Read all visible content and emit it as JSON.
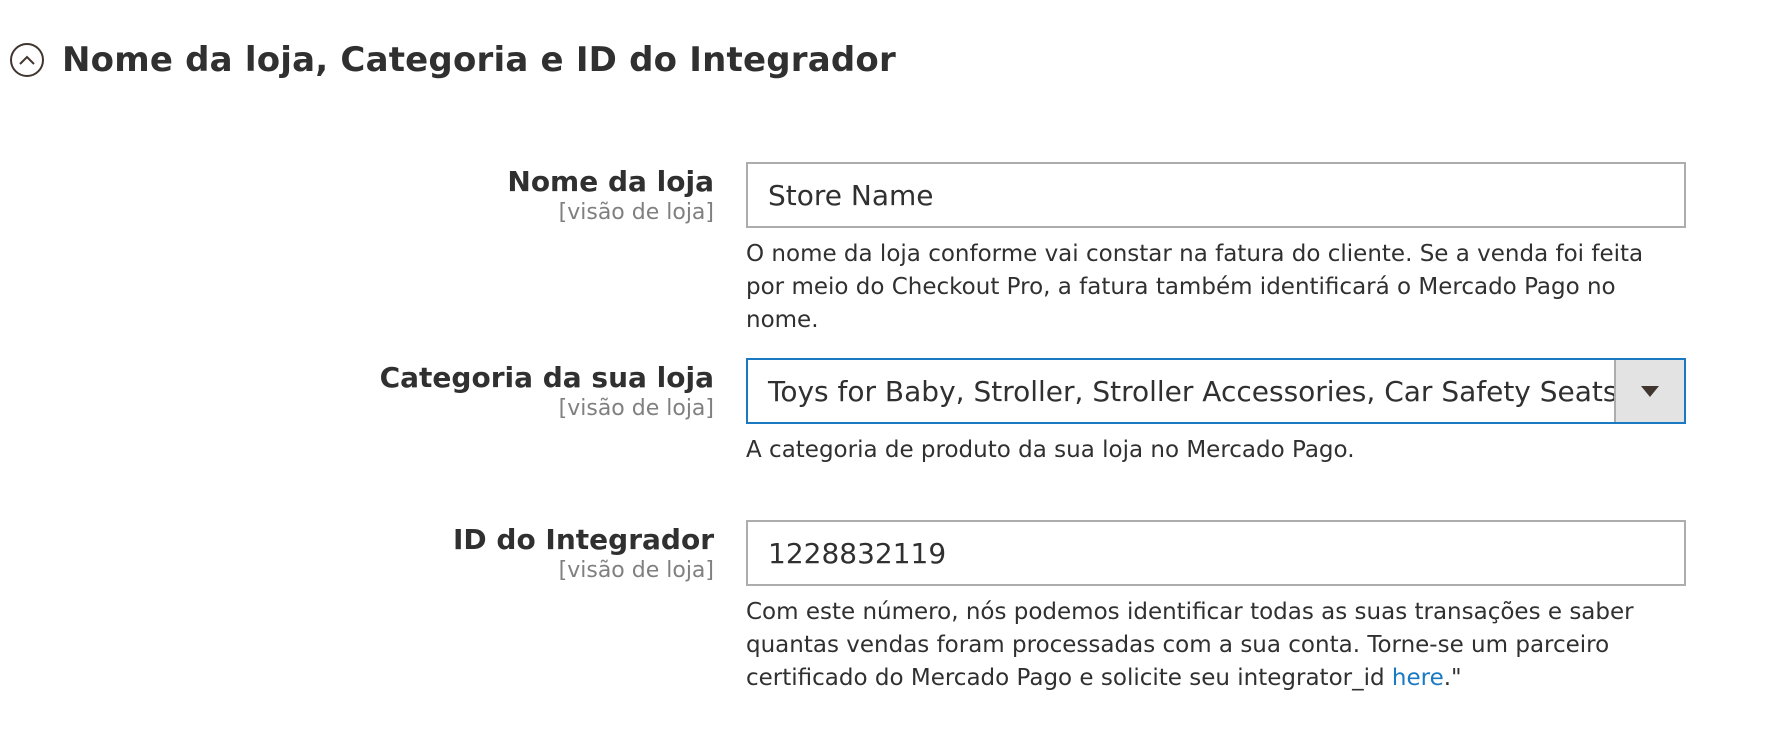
{
  "section": {
    "title": "Nome da loja, Categoria e ID do Integrador",
    "toggle_icon": "chevron-up-circle-icon"
  },
  "fields": {
    "store_name": {
      "label": "Nome da loja",
      "scope": "[visão de loja]",
      "value": "Store Name",
      "note": "O nome da loja conforme vai constar na fatura do cliente. Se a venda foi feita por meio do Checkout Pro, a fatura também identificará o Mercado Pago no nome."
    },
    "store_category": {
      "label": "Categoria da sua loja",
      "scope": "[visão de loja]",
      "selected": "Toys for Baby, Stroller, Stroller Accessories, Car Safety Seats",
      "arrow_icon": "triangle-down-icon",
      "note": "A categoria de produto da sua loja no Mercado Pago."
    },
    "integrator_id": {
      "label": "ID do Integrador",
      "scope": "[visão de loja]",
      "value": "1228832119",
      "note_text": "Com este número, nós podemos identificar todas as suas transações e saber quantas vendas foram processadas com a sua conta. Torne-se um parceiro certificado do Mercado Pago e solicite seu integrator_id ",
      "note_link": "here",
      "note_suffix": ".\""
    }
  },
  "colors": {
    "text": "#303030",
    "scope": "#808080",
    "input_border": "#adadad",
    "focus_border": "#1979c3",
    "link": "#1979c3",
    "select_button": "#e3e3e3"
  }
}
